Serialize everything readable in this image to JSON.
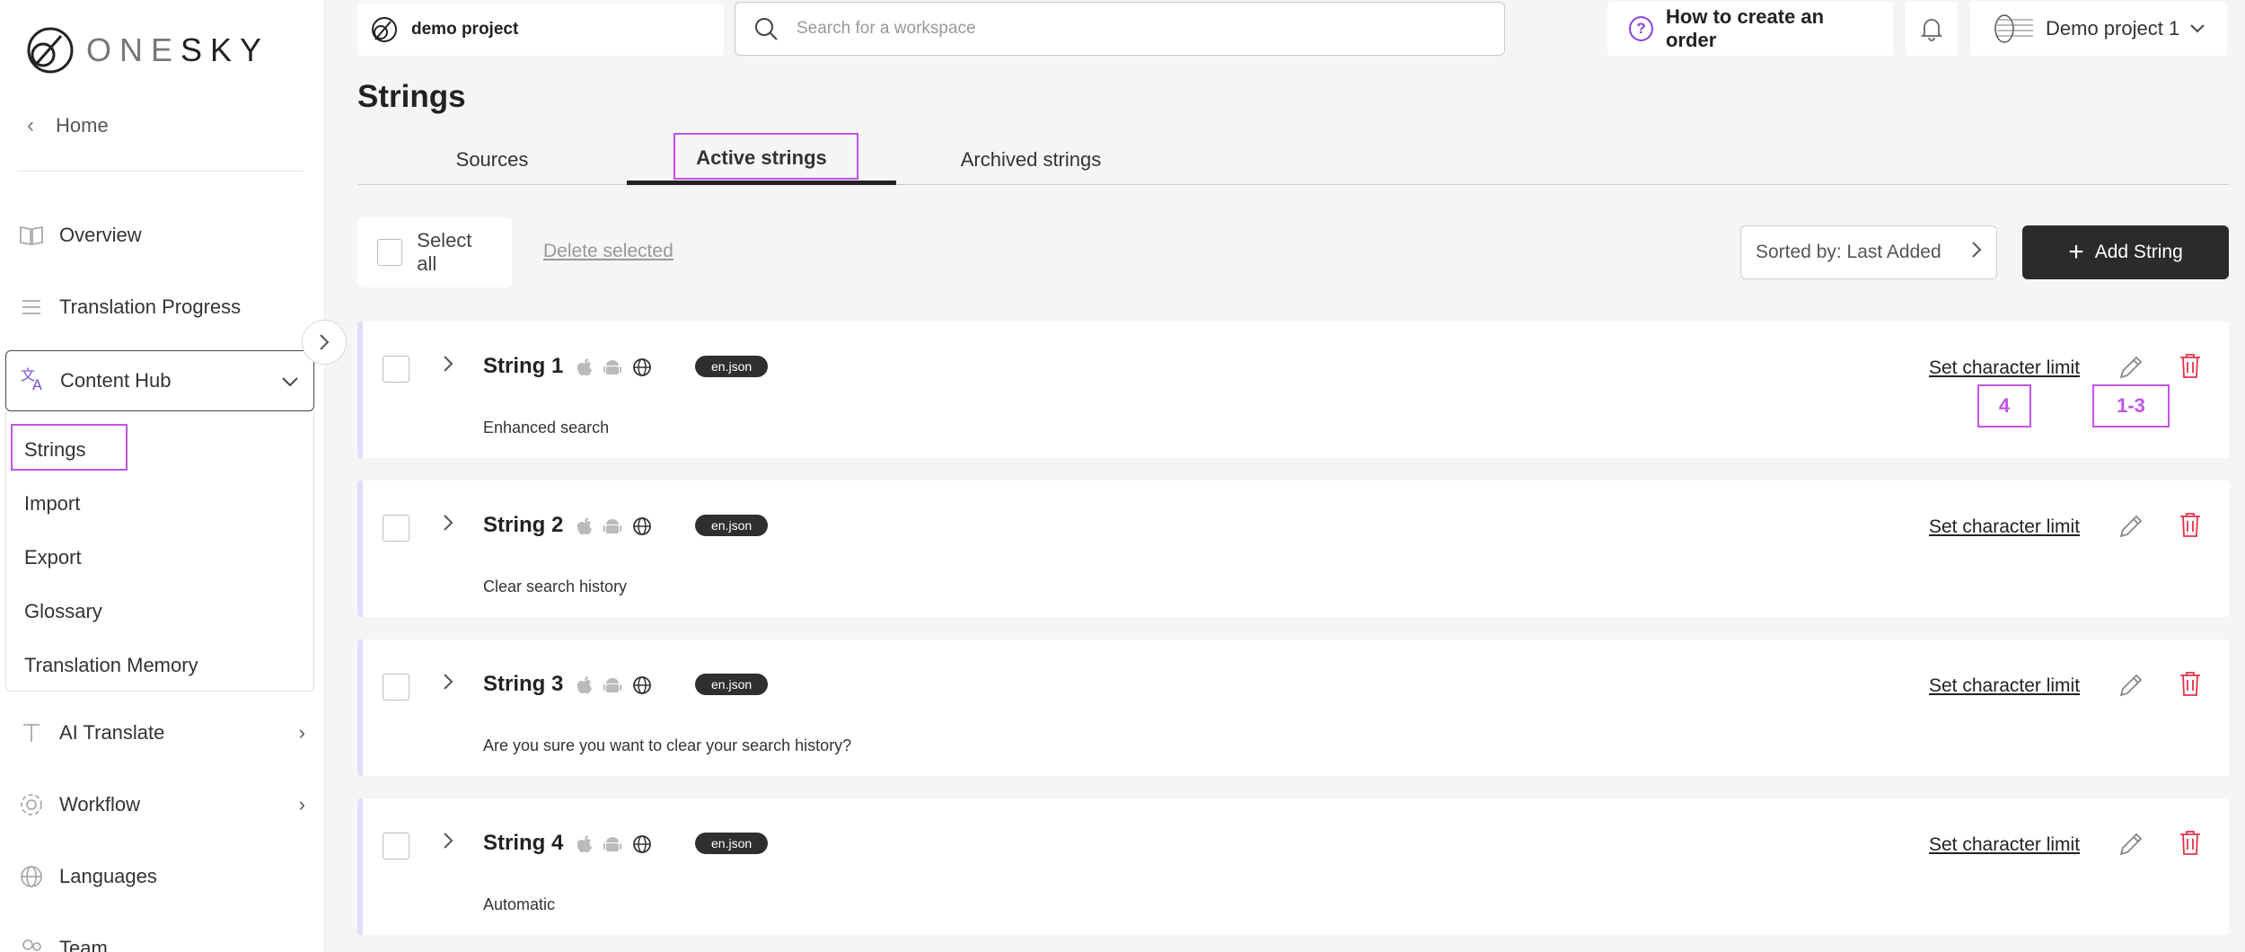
{
  "brand": {
    "name_one": "ONE",
    "name_sky": "SKY"
  },
  "sidebar": {
    "home_label": "Home",
    "items": [
      {
        "label": "Overview",
        "icon": "book-icon"
      },
      {
        "label": "Translation Progress",
        "icon": "list-icon"
      },
      {
        "label": "Content Hub",
        "icon": "translate-icon"
      },
      {
        "label": "AI Translate",
        "icon": "text-icon"
      },
      {
        "label": "Workflow",
        "icon": "gear-icon"
      },
      {
        "label": "Languages",
        "icon": "globe-icon"
      },
      {
        "label": "Team",
        "icon": "team-icon"
      }
    ],
    "content_hub_submenu": [
      "Strings",
      "Import",
      "Export",
      "Glossary",
      "Translation Memory"
    ]
  },
  "topbar": {
    "project": "demo project",
    "search_placeholder": "Search for a workspace",
    "howto_label": "How to create an order",
    "account_label": "Demo project 1"
  },
  "page": {
    "title": "Strings",
    "tabs": [
      "Sources",
      "Active strings",
      "Archived strings"
    ],
    "active_tab": "Active strings"
  },
  "toolbar": {
    "select_all": "Select all",
    "delete_selected": "Delete selected",
    "sort_label": "Sorted by: Last Added",
    "add_label": "Add String"
  },
  "strings": [
    {
      "name": "String 1",
      "file": "en.json",
      "text": "Enhanced search"
    },
    {
      "name": "String 2",
      "file": "en.json",
      "text": "Clear search history"
    },
    {
      "name": "String 3",
      "file": "en.json",
      "text": "Are you sure you want to clear your search history?"
    },
    {
      "name": "String 4",
      "file": "en.json",
      "text": "Automatic"
    }
  ],
  "row_actions": {
    "char_limit": "Set character limit"
  },
  "annotations": {
    "char_limit_marker": "4",
    "actions_marker": "1-3"
  },
  "colors": {
    "accent": "#c154e8",
    "delete": "#e0334b",
    "brand_purple": "#8b3fe0"
  }
}
